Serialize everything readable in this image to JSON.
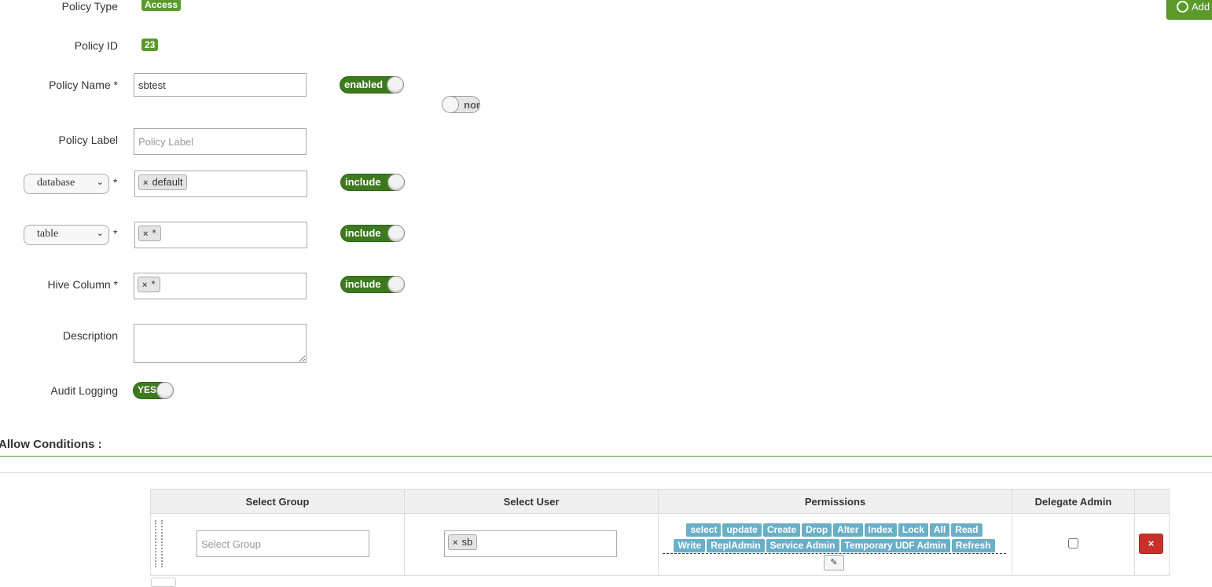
{
  "header": {
    "add_button_label": "Add",
    "add_icon": "clock-circle-icon"
  },
  "policy_type": {
    "label": "Policy Type",
    "value": "Access"
  },
  "policy_id": {
    "label": "Policy ID",
    "value": "23"
  },
  "policy_name": {
    "label": "Policy Name *",
    "value": "sbtest",
    "status_toggle": "enabled",
    "override_toggle": "nor"
  },
  "policy_label": {
    "label": "Policy Label",
    "placeholder": "Policy Label"
  },
  "resources": [
    {
      "select_value": "database",
      "required": "*",
      "values": [
        "default"
      ],
      "toggle": "include"
    },
    {
      "select_value": "table",
      "required": "*",
      "values": [
        "*"
      ],
      "toggle": "include"
    },
    {
      "label": "Hive Column *",
      "values": [
        "*"
      ],
      "toggle": "include"
    }
  ],
  "description": {
    "label": "Description",
    "value": ""
  },
  "audit_logging": {
    "label": "Audit Logging",
    "value": "YES"
  },
  "allow_conditions": {
    "title": "Allow Conditions :",
    "columns": [
      "Select Group",
      "Select User",
      "Permissions",
      "Delegate Admin"
    ],
    "row": {
      "group_placeholder": "Select Group",
      "users": [
        "sb"
      ],
      "permissions": [
        "select",
        "update",
        "Create",
        "Drop",
        "Alter",
        "Index",
        "Lock",
        "All",
        "Read",
        "Write",
        "ReplAdmin",
        "Service Admin",
        "Temporary UDF Admin",
        "Refresh"
      ],
      "delegate_admin": false
    }
  },
  "colors": {
    "accent_green": "#3d7a1e",
    "permission_tag": "#6aafc8",
    "delete_red": "#c9302c"
  }
}
